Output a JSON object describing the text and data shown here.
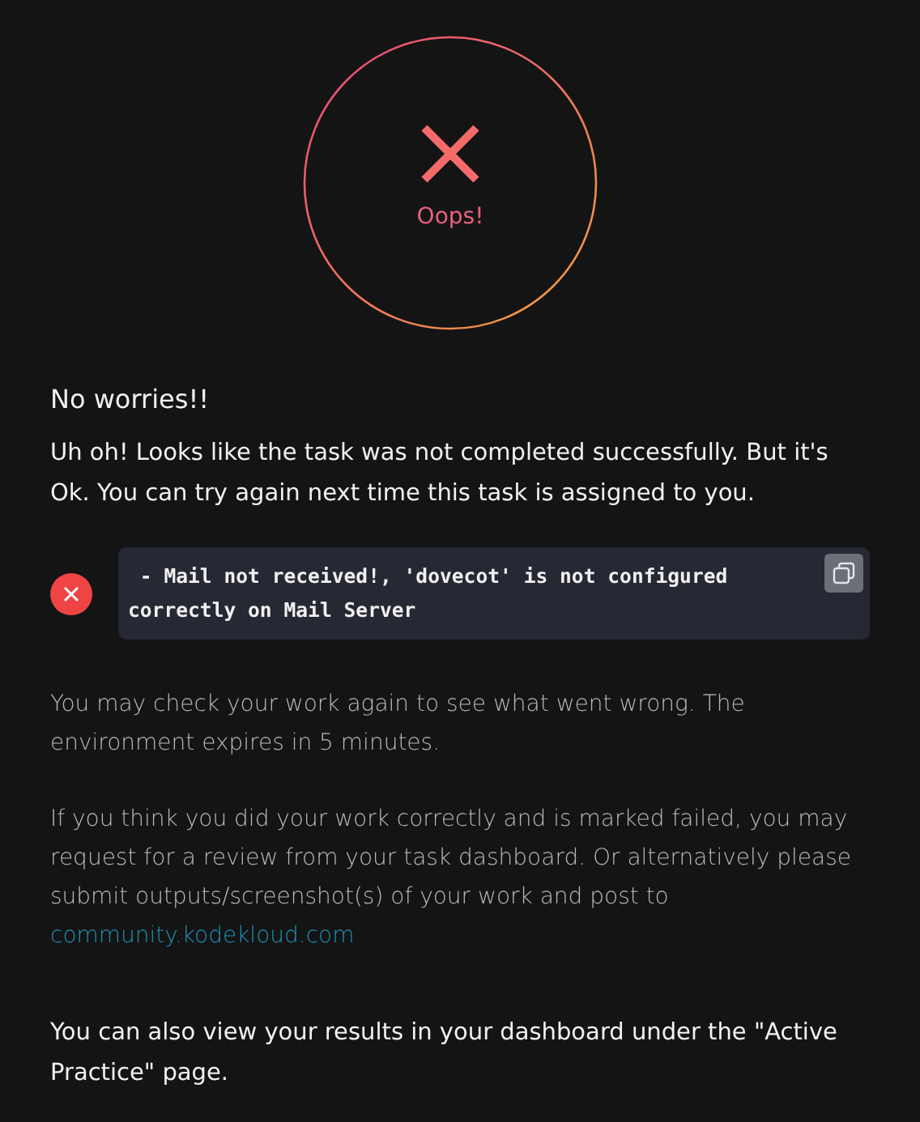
{
  "status": {
    "label": "Oops!"
  },
  "heading": "No worries!!",
  "message": "Uh oh! Looks like the task was not completed successfully. But it's Ok. You can try again next time this task is assigned to you.",
  "errors": [
    {
      "text": " - Mail not received!, 'dovecot' is not configured correctly on Mail Server"
    }
  ],
  "note": "You may check your work again to see what went wrong. The environment expires in 5 minutes.",
  "review": {
    "text": "If you think you did your work correctly and is marked failed, you may request for a review from your task dashboard. Or alternatively please submit outputs/screenshot(s) of your work and post to",
    "link": "community.kodekloud.com"
  },
  "footer": "You can also view your results in your dashboard under the \"Active Practice\" page."
}
